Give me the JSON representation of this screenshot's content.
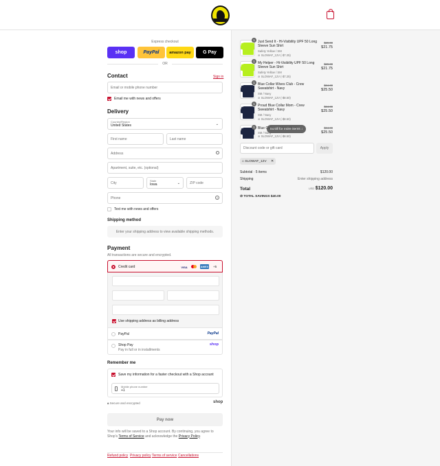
{
  "header": {
    "logo_alt": "Brand logo",
    "cart_icon": "shopping-bag-icon"
  },
  "express": {
    "title": "Express checkout",
    "buttons": {
      "shop": "shop",
      "paypal": "PayPal",
      "amazon": "amazon pay",
      "gpay": "G Pay"
    },
    "or": "OR"
  },
  "contact": {
    "heading": "Contact",
    "signin": "Sign in",
    "email_placeholder": "Email or mobile phone number",
    "news_label": "Email me with news and offers"
  },
  "delivery": {
    "heading": "Delivery",
    "country_label": "Country/Region",
    "country_value": "United States",
    "first_name": "First name",
    "last_name": "Last name",
    "address": "Address",
    "apartment": "Apartment, suite, etc. (optional)",
    "city": "City",
    "state_label": "State",
    "state_value": "Iowa",
    "zip": "ZIP code",
    "phone": "Phone",
    "text_label": "Text me with news and offers"
  },
  "shipping": {
    "heading": "Shipping method",
    "notice": "Enter your shipping address to view available shipping methods."
  },
  "payment": {
    "heading": "Payment",
    "subtitle": "All transactions are secure and encrypted.",
    "credit_card": "Credit card",
    "card_brands": [
      "VISA",
      "MC",
      "AMEX"
    ],
    "more_cards": "+5",
    "billing_label": "Use shipping address as billing address",
    "paypal_label": "PayPal",
    "paypal_logo": "PayPal",
    "shoppay_label": "Shop Pay",
    "shoppay_sub": "Pay in full or in installments",
    "shoppay_logo": "shop"
  },
  "remember": {
    "heading": "Remember me",
    "save_label": "Save my information for a faster checkout with a Shop account",
    "mobile_label": "Mobile phone number",
    "mobile_value": "+1",
    "secure": "Secure and encrypted",
    "shop_logo": "shop"
  },
  "paynow": "Pay now",
  "legal": {
    "text": "Your info will be saved to a Shop account. By continuing, you agree to Shop's",
    "terms": "Terms of Service",
    "and": "and acknowledge the",
    "privacy": "Privacy Policy"
  },
  "footer": [
    "Refund policy",
    "Privacy policy",
    "Terms of service",
    "Cancellations"
  ],
  "cart": {
    "items": [
      {
        "qty": "1",
        "name": "Just Send It - Hi-Visibility UPF 50 Long Sleeve Sun Shirt",
        "variant": "Safety Yellow / SM",
        "discount": "SLOWAF_12V (-$7.25)",
        "original": "$29.00",
        "price": "$21.75",
        "color": "#b7ef1f"
      },
      {
        "qty": "1",
        "name": "My Helper - Hi-Visibility UPF 50 Long Sleeve Sun Shirt",
        "variant": "Safety Yellow / SM",
        "discount": "SLOWAF_12V (-$7.25)",
        "original": "$29.00",
        "price": "$21.75",
        "color": "#b7ef1f"
      },
      {
        "qty": "1",
        "name": "Blue Collar Wives Club - Crew Sweatshirt - Navy",
        "variant": "SM / Navy",
        "discount": "SLOWAF_12V (-$8.50)",
        "original": "$34.00",
        "price": "$25.50",
        "color": "#1c2440"
      },
      {
        "qty": "1",
        "name": "Proud Blue Collar Mom - Crew Sweatshirt - Navy",
        "variant": "SM / Navy",
        "discount": "SLOWAF_12V (-$8.50)",
        "original": "$34.00",
        "price": "$25.50",
        "color": "#1c2440"
      },
      {
        "qty": "1",
        "name": "Blue Collar ... Shirt - Navy",
        "variant": "SM / Navy",
        "discount": "SLOWAF_12V (-$8.50)",
        "original": "$34.00",
        "price": "$25.50",
        "color": "#1c2440"
      }
    ],
    "scroll_hint": "Scroll for more items",
    "discount_placeholder": "Discount code or gift card",
    "apply": "Apply",
    "code_tag": "SLOWAF_12V",
    "subtotal_label": "Subtotal · 5 items",
    "subtotal_value": "$120.00",
    "shipping_label": "Shipping",
    "shipping_value": "Enter shipping address",
    "total_label": "Total",
    "currency": "USD",
    "total_value": "$120.00",
    "savings_label": "TOTAL SAVINGS",
    "savings_value": "$40.00"
  },
  "colors": {
    "accent": "#c8102e",
    "shop": "#5a31f4",
    "paypal": "#ffc439",
    "amazon": "#ffd814"
  }
}
